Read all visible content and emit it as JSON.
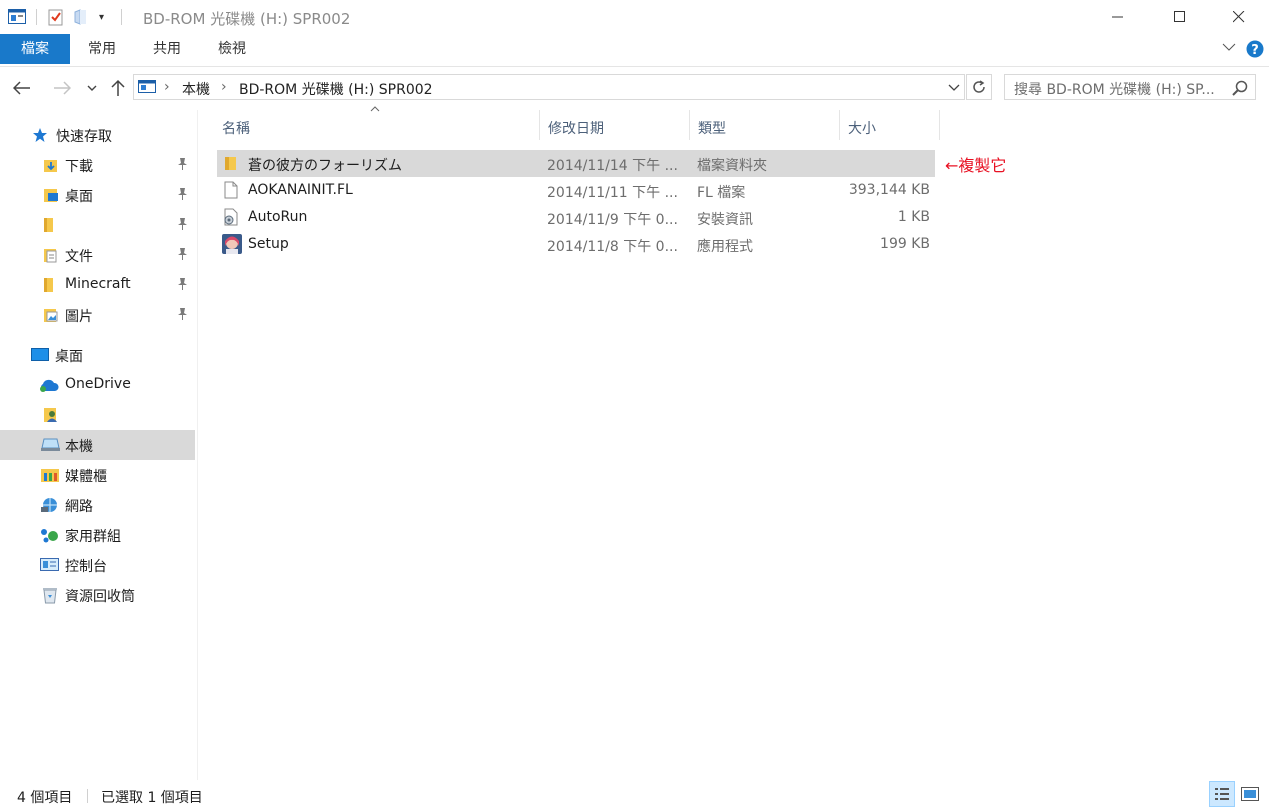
{
  "window": {
    "title": "BD-ROM 光碟機 (H:) SPR002",
    "controls": {
      "minimize": "—",
      "maximize": "☐",
      "close": "✕"
    }
  },
  "ribbon": {
    "tabs": [
      {
        "label": "檔案",
        "active": true
      },
      {
        "label": "常用"
      },
      {
        "label": "共用"
      },
      {
        "label": "檢視"
      }
    ],
    "accent_color": "#1979ca"
  },
  "address_bar": {
    "breadcrumb": [
      "本機",
      "BD-ROM 光碟機 (H:) SPR002"
    ],
    "separator": ">"
  },
  "search": {
    "placeholder": "搜尋 BD-ROM 光碟機 (H:) SP..."
  },
  "nav_pane": {
    "quick_access": {
      "label": "快速存取",
      "items": [
        {
          "label": "下載",
          "icon": "download-folder-icon",
          "pinned": true
        },
        {
          "label": "桌面",
          "icon": "desktop-folder-icon",
          "pinned": true
        },
        {
          "label": "",
          "icon": "folder-icon",
          "pinned": true
        },
        {
          "label": "文件",
          "icon": "documents-folder-icon",
          "pinned": true
        },
        {
          "label": "Minecraft",
          "icon": "folder-icon",
          "pinned": true
        },
        {
          "label": "圖片",
          "icon": "pictures-folder-icon",
          "pinned": true
        }
      ]
    },
    "tree": [
      {
        "label": "桌面",
        "icon": "desktop-icon"
      },
      {
        "label": "OneDrive",
        "icon": "onedrive-icon"
      },
      {
        "label": "",
        "icon": "user-icon"
      },
      {
        "label": "本機",
        "icon": "this-pc-icon",
        "selected": true
      },
      {
        "label": "媒體櫃",
        "icon": "libraries-icon"
      },
      {
        "label": "網路",
        "icon": "network-icon"
      },
      {
        "label": "家用群組",
        "icon": "homegroup-icon"
      },
      {
        "label": "控制台",
        "icon": "control-panel-icon"
      },
      {
        "label": "資源回收筒",
        "icon": "recycle-bin-icon"
      }
    ]
  },
  "file_list": {
    "columns": [
      "名稱",
      "修改日期",
      "類型",
      "大小"
    ],
    "sort_indicator": "^",
    "rows": [
      {
        "name": "蒼の彼方のフォーリズム",
        "date": "2014/11/14 下午 ...",
        "type": "檔案資料夾",
        "size": "",
        "icon": "folder-icon",
        "selected": true
      },
      {
        "name": "AOKANAINIT.FL",
        "date": "2014/11/11 下午 ...",
        "type": "FL 檔案",
        "size": "393,144 KB",
        "icon": "file-icon"
      },
      {
        "name": "AutoRun",
        "date": "2014/11/9 下午 0...",
        "type": "安裝資訊",
        "size": "1 KB",
        "icon": "setup-info-icon"
      },
      {
        "name": "Setup",
        "date": "2014/11/8 下午 0...",
        "type": "應用程式",
        "size": "199 KB",
        "icon": "app-icon"
      }
    ]
  },
  "annotation": {
    "text": "←複製它",
    "color": "#e81123"
  },
  "status_bar": {
    "item_count": "4 個項目",
    "selection": "已選取 1 個項目"
  }
}
